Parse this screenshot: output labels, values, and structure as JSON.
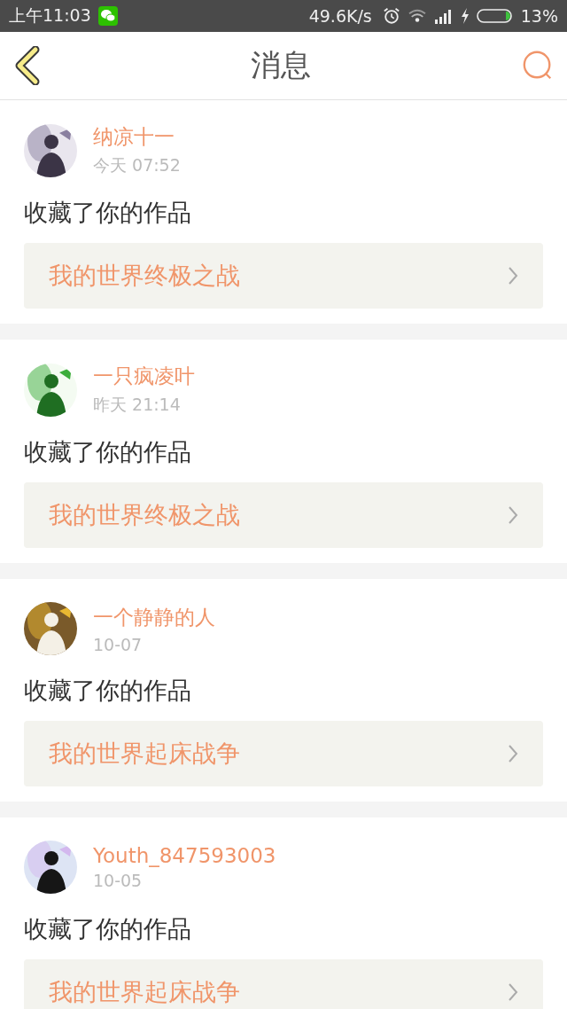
{
  "status_bar": {
    "time": "上午11:03",
    "speed": "49.6K/s",
    "battery": "13%"
  },
  "header": {
    "title": "消息"
  },
  "messages": [
    {
      "user": "纳凉十一",
      "time": "今天 07:52",
      "action": "收藏了你的作品",
      "work": "我的世界终极之战"
    },
    {
      "user": "一只疯凌叶",
      "time": "昨天 21:14",
      "action": "收藏了你的作品",
      "work": "我的世界终极之战"
    },
    {
      "user": "一个静静的人",
      "time": "10-07",
      "action": "收藏了你的作品",
      "work": "我的世界起床战争"
    },
    {
      "user": "Youth_847593003",
      "time": "10-05",
      "action": "收藏了你的作品",
      "work": "我的世界起床战争"
    }
  ]
}
